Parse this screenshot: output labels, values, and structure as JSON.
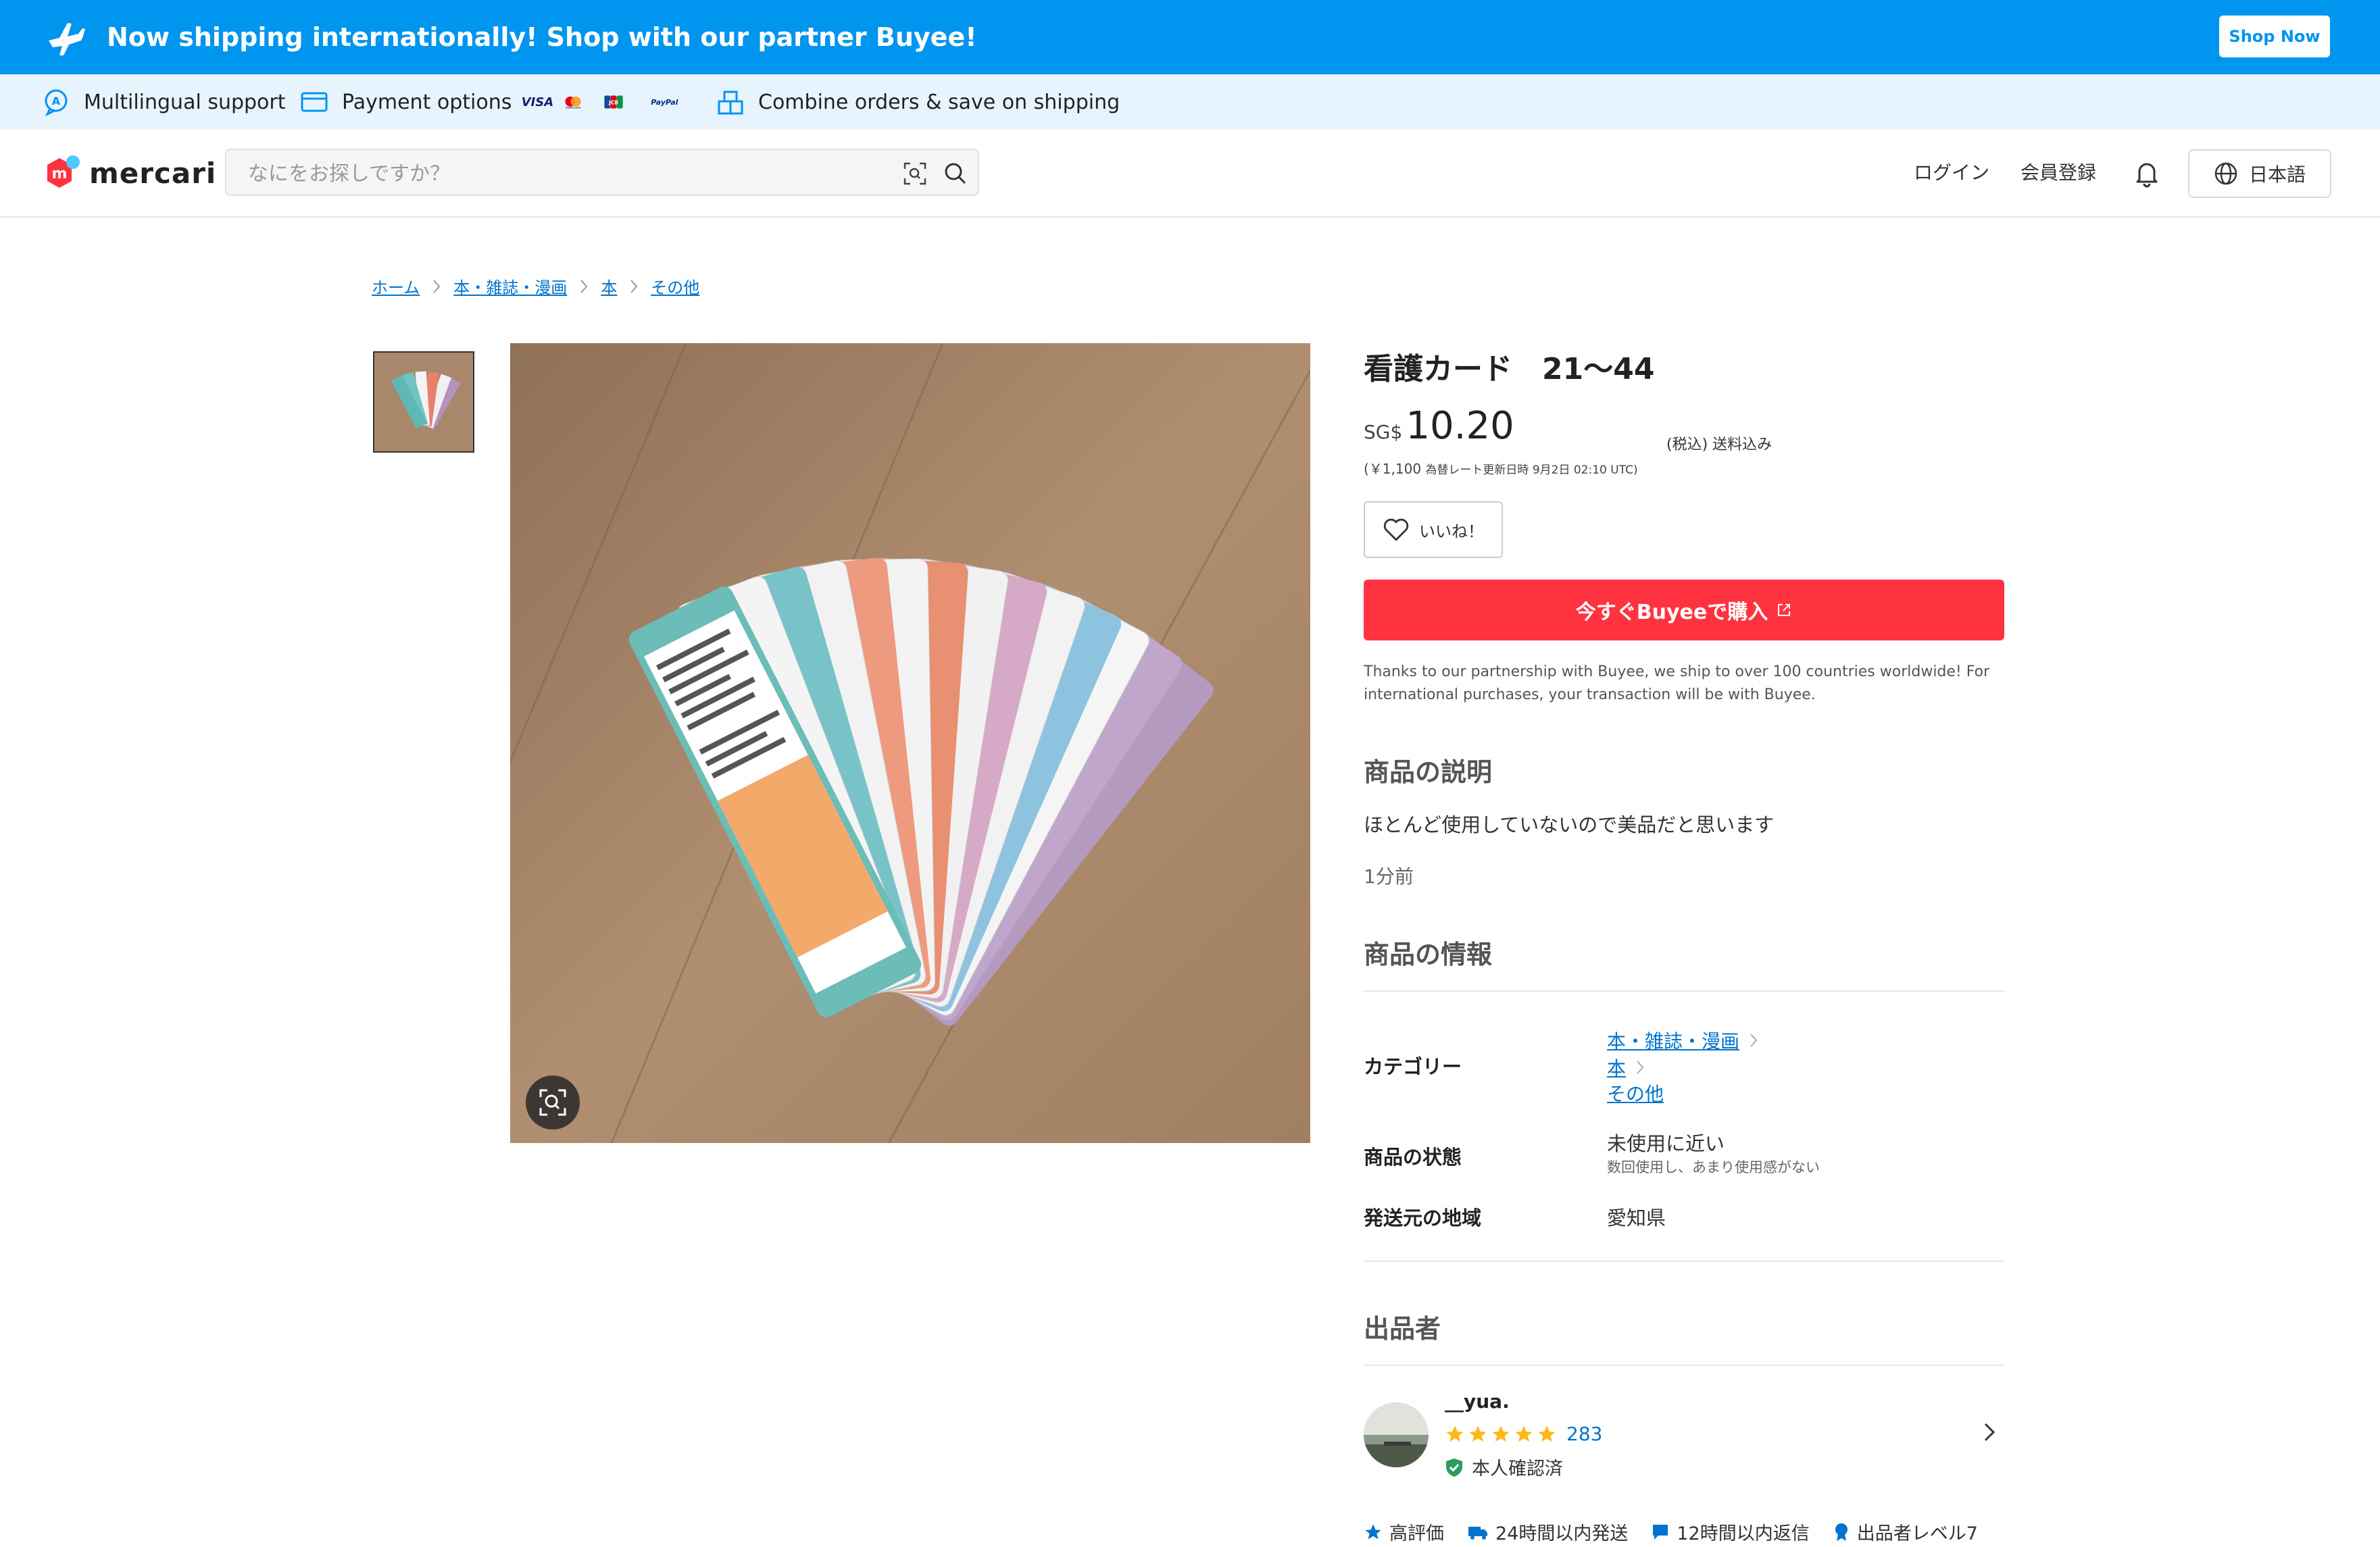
{
  "banner": {
    "text": "Now shipping internationally! Shop with our partner Buyee!",
    "button": "Shop Now"
  },
  "infobar": {
    "multilingual": "Multilingual support",
    "payment": "Payment options",
    "cards": [
      "VISA",
      "mastercard",
      "JCB",
      "PayPal"
    ],
    "combine": "Combine orders & save on shipping"
  },
  "header": {
    "logo": "mercari",
    "search_placeholder": "なにをお探しですか？",
    "login": "ログイン",
    "register": "会員登録",
    "language": "日本語"
  },
  "breadcrumb": [
    "ホーム",
    "本・雑誌・漫画",
    "本",
    "その他"
  ],
  "item": {
    "title": "看護カード　21〜44",
    "currency": "SG$",
    "price": "10.20",
    "tax_note": "(税込) 送料込み",
    "rate_yen": "(￥1,100",
    "rate_note": "為替レート更新日時 9月2日 02:10 UTC)",
    "like": "いいね！",
    "buy": "今すぐBuyeeで購入",
    "buyee_note": "Thanks to our partnership with Buyee, we ship to over 100 countries worldwide! For international purchases, your transaction will be with Buyee."
  },
  "description": {
    "heading": "商品の説明",
    "text": "ほとんど使用していないので美品だと思います",
    "posted": "1分前"
  },
  "details": {
    "heading": "商品の情報",
    "category_label": "カテゴリー",
    "categories": [
      "本・雑誌・漫画",
      "本",
      "その他"
    ],
    "condition_label": "商品の状態",
    "condition": "未使用に近い",
    "condition_sub": "数回使用し、あまり使用感がない",
    "ship_from_label": "発送元の地域",
    "ship_from": "愛知県"
  },
  "seller": {
    "heading": "出品者",
    "name": "__yua.",
    "rating_stars": 5,
    "rating_count": "283",
    "verified": "本人確認済",
    "badges": [
      "高評価",
      "24時間以内発送",
      "12時間以内返信",
      "出品者レベル7"
    ]
  },
  "colors": {
    "banner_blue": "#0095ee",
    "buy_red": "#ff333f",
    "link_blue": "#0073cc",
    "mercari_red": "#ff333f",
    "star_yellow": "#ffb818",
    "verified_green": "#2e9d5b"
  }
}
